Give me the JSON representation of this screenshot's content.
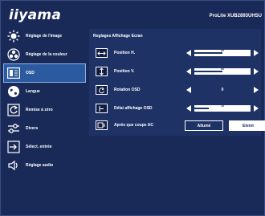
{
  "header": {
    "brand": "iiyama",
    "model": "ProLite XUB2893UHSU"
  },
  "sidebar": {
    "items": [
      {
        "label": "Réglage de l'image",
        "icon": "brightness-icon"
      },
      {
        "label": "Réglage de la couleur",
        "icon": "color-palette-icon"
      },
      {
        "label": "OSD",
        "icon": "osd-icon",
        "active": true
      },
      {
        "label": "Langue",
        "icon": "globe-icon"
      },
      {
        "label": "Remise à zéro",
        "icon": "reset-icon"
      },
      {
        "label": "Divers",
        "icon": "settings-sliders-icon"
      },
      {
        "label": "Sélect. entrée",
        "icon": "input-select-icon"
      },
      {
        "label": "Réglage audio",
        "icon": "speaker-icon"
      }
    ]
  },
  "panel": {
    "title": "Reglages Affichage Ecran",
    "rows": [
      {
        "label": "Position H.",
        "type": "slider",
        "value": 50,
        "icon": "horizontal-position-icon"
      },
      {
        "label": "Position V.",
        "type": "slider",
        "value": 50,
        "icon": "vertical-position-icon"
      },
      {
        "label": "Rotation OSD",
        "type": "value",
        "value": "0",
        "icon": "rotation-icon"
      },
      {
        "label": "Délai affichage OSD",
        "type": "slider",
        "value": 15,
        "icon": "timer-icon"
      },
      {
        "label": "Après que coupe AC",
        "type": "toggle",
        "options": [
          "Allumé",
          "Eteint"
        ],
        "selected": "Eteint",
        "icon": "ac-power-icon"
      }
    ]
  },
  "colors": {
    "background": "#1a2a58",
    "panel": "#1f3266",
    "active": "#2b5aa0",
    "text": "#ffffff"
  }
}
